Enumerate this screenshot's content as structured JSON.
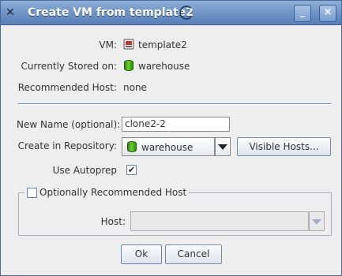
{
  "window": {
    "title": "Create VM from template2",
    "minimize_glyph": "_",
    "close_glyph": "×"
  },
  "info": {
    "vm_label": "VM:",
    "vm_value": "template2",
    "stored_label": "Currently Stored on:",
    "stored_value": "warehouse",
    "recommended_label": "Recommended Host:",
    "recommended_value": "none"
  },
  "form": {
    "new_name_label": "New Name (optional):",
    "new_name_value": "clone2-2",
    "repository_label": "Create in Repository:",
    "repository_value": "warehouse",
    "visible_hosts_button": "Visible Hosts...",
    "autoprep_label": "Use Autoprep",
    "autoprep_checked": true
  },
  "group": {
    "checkbox_label": "Optionally Recommended Host",
    "checked": false,
    "host_label": "Host:",
    "host_value": ""
  },
  "buttons": {
    "ok": "Ok",
    "cancel": "Cancel"
  },
  "icons": {
    "app": "x-logo-icon",
    "vm": "vm-icon",
    "storage": "database-icon"
  },
  "colors": {
    "titlebar": "#6f93c4",
    "storage_green": "#4cb020"
  }
}
